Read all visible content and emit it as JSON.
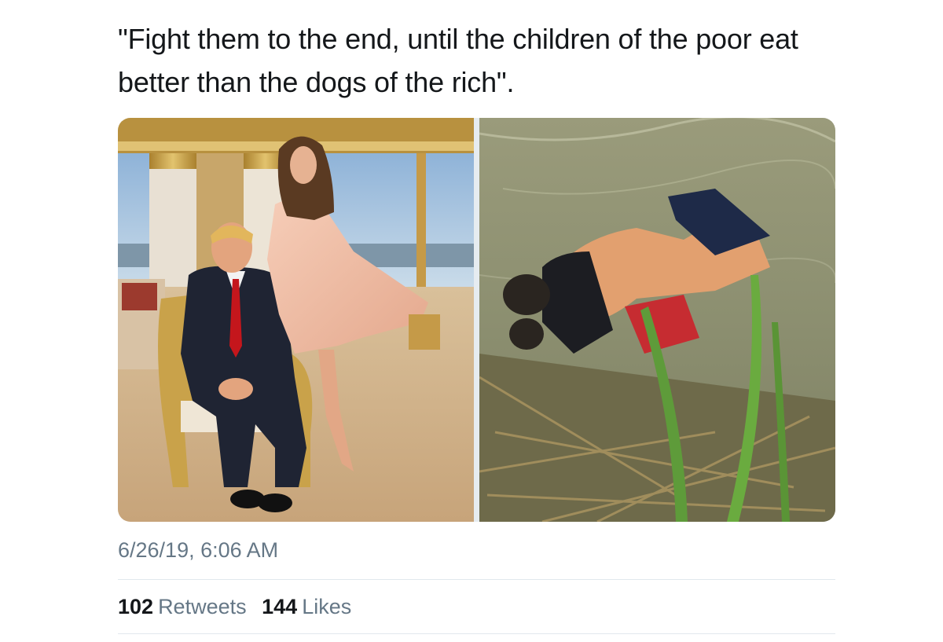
{
  "tweet": {
    "text": "\"Fight them to the end, until the children of the poor eat better than the dogs of the rich\".",
    "timestamp": "6/26/19, 6:06 AM",
    "retweets": {
      "count": "102",
      "label": "Retweets"
    },
    "likes": {
      "count": "144",
      "label": "Likes"
    }
  },
  "colors": {
    "text_primary": "#14171a",
    "text_secondary": "#657786",
    "divider": "#e1e8ed",
    "background": "#ffffff"
  }
}
